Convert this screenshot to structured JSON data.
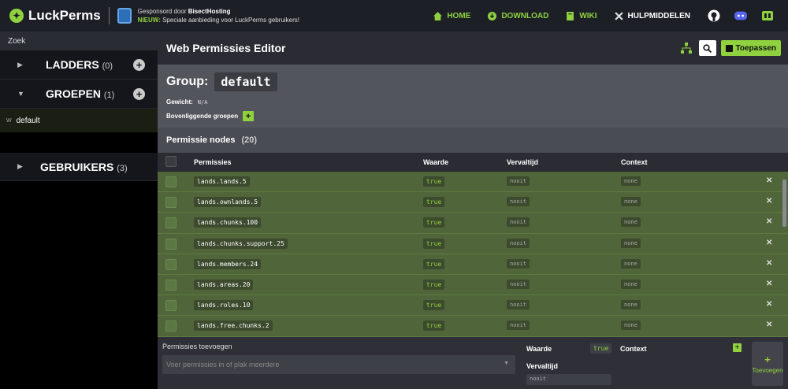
{
  "header": {
    "brand": "LuckPerms",
    "sponsor_line1_prefix": "Gesponsord door ",
    "sponsor_name": "BisectHosting",
    "sponsor_line2_new": "NIEUW:",
    "sponsor_line2_text": " Speciale aanbieding voor LuckPerms gebruikers!",
    "nav": [
      {
        "label": "HOME",
        "icon": "home-icon"
      },
      {
        "label": "DOWNLOAD",
        "icon": "download-icon"
      },
      {
        "label": "WIKI",
        "icon": "book-icon"
      },
      {
        "label": "HULPMIDDELEN",
        "icon": "tools-icon"
      }
    ],
    "nav_icons": [
      "github-icon",
      "discord-icon",
      "patreon-icon"
    ],
    "accent": "#8fd13f"
  },
  "sidebar": {
    "search_label": "Zoek",
    "sections": [
      {
        "title": "LADDERS",
        "count": "(0)",
        "expanded": false
      },
      {
        "title": "GROEPEN",
        "count": "(1)",
        "expanded": true
      },
      {
        "title": "GEBRUIKERS",
        "count": "(3)",
        "expanded": false
      }
    ],
    "group_items": [
      {
        "weight": "W",
        "name": "default"
      }
    ]
  },
  "editor": {
    "title": "Web Permissies Editor",
    "apply_label": "Toepassen",
    "group_label": "Group:",
    "group_name": "default",
    "weight_label": "Gewicht:",
    "weight_value": "N/A",
    "parents_label": "Bovenliggende groepen",
    "parents_add": "+",
    "nodes_title": "Permissie nodes",
    "nodes_count": "(20)",
    "columns": {
      "permission": "Permissies",
      "value": "Waarde",
      "expiry": "Vervaltijd",
      "context": "Context"
    },
    "rows": [
      {
        "node": "lands.lands.5",
        "value": "true",
        "expiry": "nooit",
        "context": "none"
      },
      {
        "node": "lands.ownlands.5",
        "value": "true",
        "expiry": "nooit",
        "context": "none"
      },
      {
        "node": "lands.chunks.100",
        "value": "true",
        "expiry": "nooit",
        "context": "none"
      },
      {
        "node": "lands.chunks.support.25",
        "value": "true",
        "expiry": "nooit",
        "context": "none"
      },
      {
        "node": "lands.members.24",
        "value": "true",
        "expiry": "nooit",
        "context": "none"
      },
      {
        "node": "lands.areas.20",
        "value": "true",
        "expiry": "nooit",
        "context": "none"
      },
      {
        "node": "lands.roles.10",
        "value": "true",
        "expiry": "nooit",
        "context": "none"
      },
      {
        "node": "lands.free.chunks.2",
        "value": "true",
        "expiry": "nooit",
        "context": "none"
      }
    ],
    "delete_glyph": "✕"
  },
  "add_panel": {
    "title": "Permissies toevoegen",
    "input_placeholder": "Voer permissies in of plak meerdere",
    "value_label": "Waarde",
    "value": "true",
    "expiry_label": "Vervaltijd",
    "expiry_value": "nooit",
    "context_label": "Context",
    "context_add": "+",
    "add_button_plus": "+",
    "add_button_label": "Toevoegen"
  }
}
